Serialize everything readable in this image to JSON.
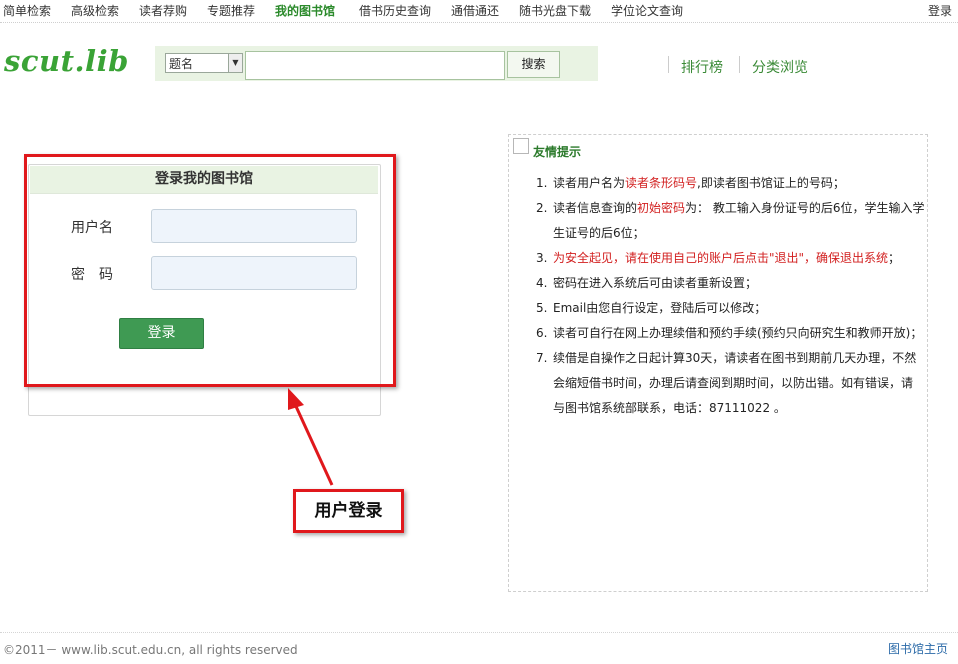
{
  "nav": {
    "items": [
      {
        "label": "简单检索"
      },
      {
        "label": "高级检索"
      },
      {
        "label": "读者荐购"
      },
      {
        "label": "专题推荐"
      },
      {
        "label": "我的图书馆"
      },
      {
        "label": "借书历史查询"
      },
      {
        "label": "通借通还"
      },
      {
        "label": "随书光盘下载"
      },
      {
        "label": "学位论文查询"
      }
    ],
    "active_item": "我的图书馆",
    "login_label": "登录"
  },
  "header": {
    "logo_text": "scut.lib",
    "search": {
      "field_select": "题名",
      "query_value": "",
      "button_label": "搜索"
    },
    "links": [
      "排行榜",
      "分类浏览"
    ]
  },
  "login": {
    "title": "登录我的图书馆",
    "username_label": "用户名",
    "password_label": "密　码",
    "username_value": "",
    "password_value": "",
    "submit_label": "登录",
    "callout_label": "用户登录"
  },
  "tips": {
    "title": "友情提示",
    "items": [
      {
        "n": "1.",
        "lines": [
          [
            {
              "t": "读者用户名为"
            },
            {
              "t": "读者条形码号",
              "red": true
            },
            {
              "t": ",即读者图书馆证上的号码；"
            }
          ]
        ]
      },
      {
        "n": "2.",
        "lines": [
          [
            {
              "t": "读者信息查询的"
            },
            {
              "t": "初始密码",
              "red": true
            },
            {
              "t": "为： 教工输入身份证号的后6位，学生输入学"
            }
          ],
          [
            {
              "t": "生证号的后6位；"
            }
          ]
        ]
      },
      {
        "n": "3.",
        "lines": [
          [
            {
              "t": "为安全起见，请在使用自己的账户后点击\"退出\"，确保退出系统",
              "red": true
            },
            {
              "t": "；"
            }
          ]
        ]
      },
      {
        "n": "4.",
        "lines": [
          [
            {
              "t": "密码在进入系统后可由读者重新设置；"
            }
          ]
        ]
      },
      {
        "n": "5.",
        "lines": [
          [
            {
              "t": "Email由您自行设定，登陆后可以修改；"
            }
          ]
        ]
      },
      {
        "n": "6.",
        "lines": [
          [
            {
              "t": "读者可自行在网上办理续借和预约手续(预约只向研究生和教师开放)；"
            }
          ]
        ]
      },
      {
        "n": "7.",
        "lines": [
          [
            {
              "t": "续借是自操作之日起计算30天，请读者在图书到期前几天办理，不然"
            }
          ],
          [
            {
              "t": "会缩短借书时间，办理后请查阅到期时间，以防出错。如有错误，请"
            }
          ],
          [
            {
              "t": "与图书馆系统部联系，电话：87111022 。"
            }
          ]
        ]
      }
    ]
  },
  "footer": {
    "copyright": "©2011－ www.lib.scut.edu.cn, all rights reserved",
    "home_link": "图书馆主页"
  },
  "colors": {
    "accent_green": "#3aa336",
    "highlight_red": "#e0181c",
    "button_green": "#3f9a53"
  }
}
